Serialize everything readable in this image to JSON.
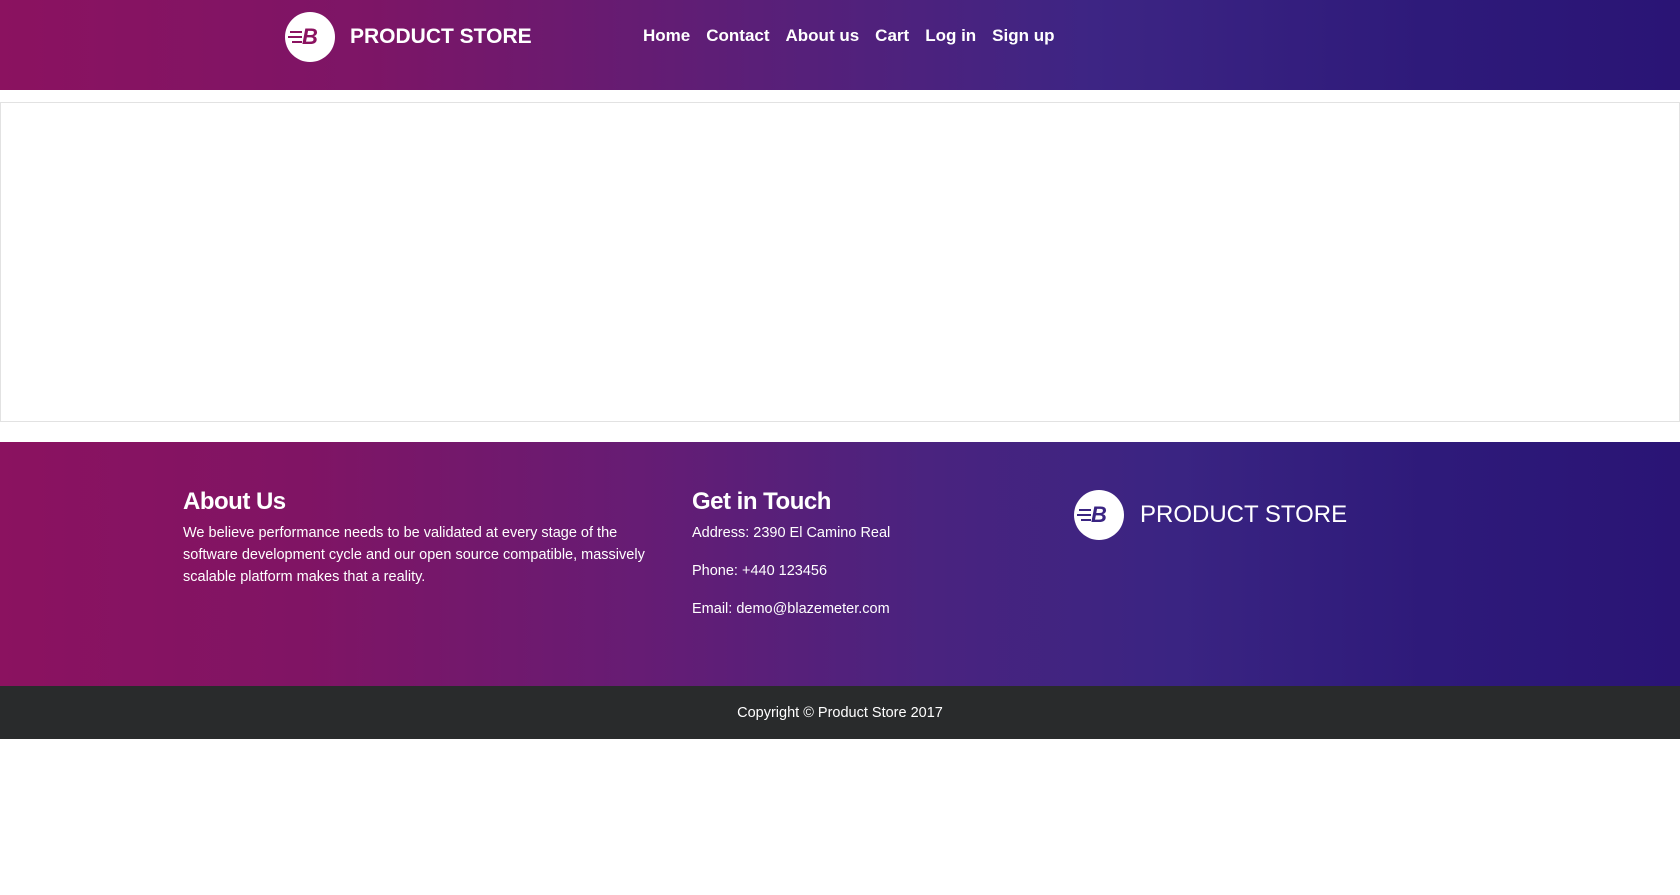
{
  "navbar": {
    "brand_text": "PRODUCT STORE",
    "logo_letter": "B",
    "logo_icon": "blazemeter-logo-icon",
    "links": [
      {
        "label": "Home"
      },
      {
        "label": "Contact"
      },
      {
        "label": "About us"
      },
      {
        "label": "Cart"
      },
      {
        "label": "Log in"
      },
      {
        "label": "Sign up"
      }
    ]
  },
  "footer": {
    "about": {
      "title": "About Us",
      "text": "We believe performance needs to be validated at every stage of the software development cycle and our open source compatible, massively scalable platform makes that a reality."
    },
    "contact": {
      "title": "Get in Touch",
      "address": "Address: 2390 El Camino Real",
      "phone": "Phone: +440 123456",
      "email": "Email: demo@blazemeter.com"
    },
    "brand_text": "PRODUCT STORE",
    "logo_letter": "B"
  },
  "copyright": "Copyright © Product Store 2017",
  "colors": {
    "gradient_start": "#8b1260",
    "gradient_end": "#2a1475",
    "logo_header": "#8b1260",
    "logo_footer": "#3a2482",
    "copyright_bg": "#292b2c"
  }
}
